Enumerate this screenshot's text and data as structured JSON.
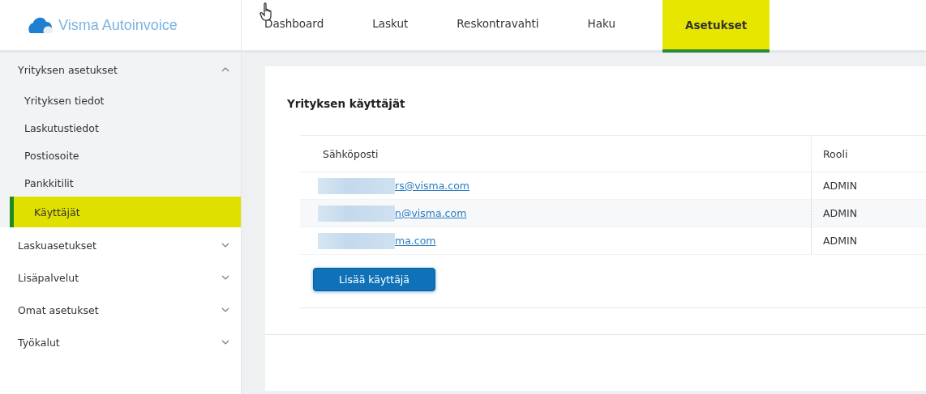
{
  "logo": {
    "text": "Visma Autoinvoice"
  },
  "nav_tabs": [
    {
      "label": "Dashboard",
      "selected": false
    },
    {
      "label": "Laskut",
      "selected": false
    },
    {
      "label": "Reskontravahti",
      "selected": false
    },
    {
      "label": "Haku",
      "selected": false
    },
    {
      "label": "Asetukset",
      "selected": true
    }
  ],
  "sidebar": {
    "groups": [
      {
        "label": "Yrityksen asetukset",
        "expanded": true,
        "children": [
          {
            "label": "Yrityksen tiedot",
            "selected": false
          },
          {
            "label": "Laskutustiedot",
            "selected": false
          },
          {
            "label": "Postiosoite",
            "selected": false
          },
          {
            "label": "Pankkitilit",
            "selected": false
          },
          {
            "label": "Käyttäjät",
            "selected": true
          }
        ]
      },
      {
        "label": "Laskuasetukset",
        "expanded": false
      },
      {
        "label": "Lisäpalvelut",
        "expanded": false
      },
      {
        "label": "Omat asetukset",
        "expanded": false
      },
      {
        "label": "Työkalut",
        "expanded": false
      }
    ]
  },
  "card": {
    "title": "Yrityksen käyttäjät",
    "table": {
      "columns": [
        "Sähköposti",
        "Rooli"
      ],
      "rows": [
        {
          "email": "rs@visma.com",
          "role": "ADMIN",
          "redacted": true
        },
        {
          "email": "n@visma.com",
          "role": "ADMIN",
          "redacted": true
        },
        {
          "email": "ma.com",
          "role": "ADMIN",
          "redacted": true
        }
      ]
    },
    "button": "Lisää käyttäjä"
  }
}
